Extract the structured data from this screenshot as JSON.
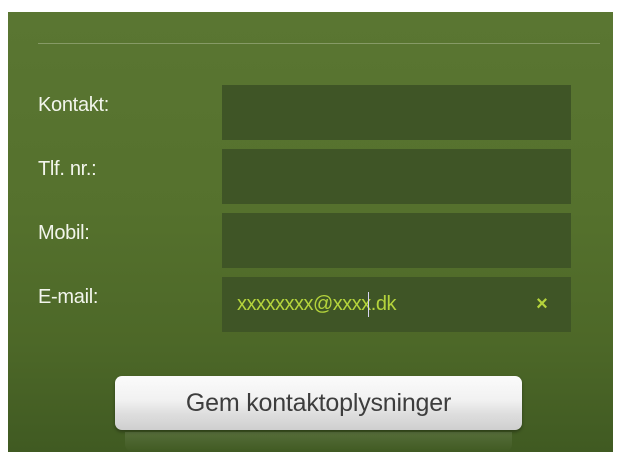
{
  "form": {
    "fields": [
      {
        "label": "Kontakt:",
        "value": ""
      },
      {
        "label": "Tlf. nr.:",
        "value": ""
      },
      {
        "label": "Mobil:",
        "value": ""
      },
      {
        "label": "E-mail:",
        "value": "xxxxxxxx@xxxx.dk"
      }
    ],
    "clear_icon": "×",
    "save_label": "Gem kontaktoplysninger"
  },
  "colors": {
    "panel_background": "#55712d",
    "field_background": "#3f5526",
    "input_text": "#b5d43c",
    "label_text": "#f2f5ec"
  },
  "icons": {
    "clear": "close-icon"
  }
}
